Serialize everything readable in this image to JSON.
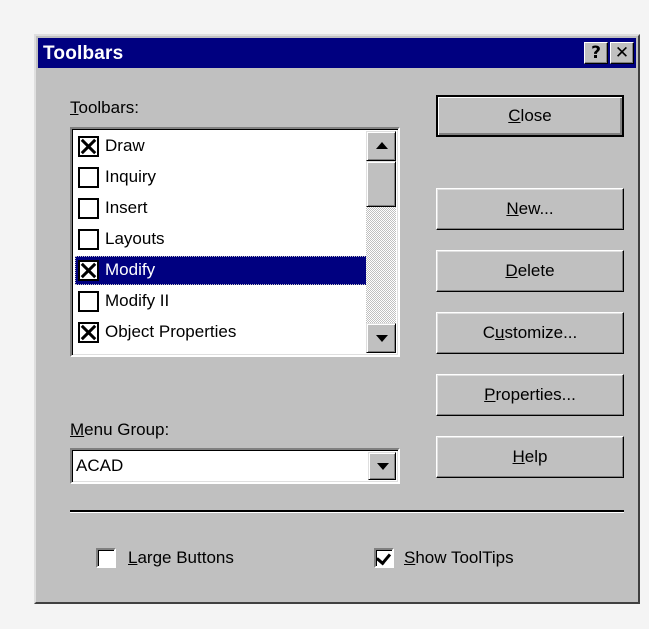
{
  "title": "Toolbars",
  "title_buttons": {
    "help": "?",
    "close": "✕"
  },
  "toolbars_label": {
    "mnemonic": "T",
    "rest": "oolbars:"
  },
  "toolbar_list": [
    {
      "label": "Draw",
      "checked": true,
      "selected": false
    },
    {
      "label": "Inquiry",
      "checked": false,
      "selected": false
    },
    {
      "label": "Insert",
      "checked": false,
      "selected": false
    },
    {
      "label": "Layouts",
      "checked": false,
      "selected": false
    },
    {
      "label": "Modify",
      "checked": true,
      "selected": true
    },
    {
      "label": "Modify II",
      "checked": false,
      "selected": false
    },
    {
      "label": "Object Properties",
      "checked": true,
      "selected": false
    }
  ],
  "menu_group": {
    "label_mnemonic": "M",
    "label_rest": "enu Group:",
    "value": "ACAD"
  },
  "buttons": {
    "close": {
      "mnemonic": "C",
      "rest": "lose"
    },
    "new": {
      "mnemonic": "N",
      "rest": "ew..."
    },
    "delete": {
      "mnemonic": "D",
      "rest": "elete"
    },
    "customize": {
      "pre": "C",
      "mnemonic": "u",
      "rest": "stomize..."
    },
    "properties": {
      "mnemonic": "P",
      "rest": "roperties..."
    },
    "help": {
      "mnemonic": "H",
      "rest": "elp"
    }
  },
  "options": {
    "large_buttons": {
      "mnemonic": "L",
      "rest": "arge Buttons",
      "checked": false
    },
    "show_tooltips": {
      "mnemonic": "S",
      "rest": "how ToolTips",
      "checked": true
    }
  }
}
